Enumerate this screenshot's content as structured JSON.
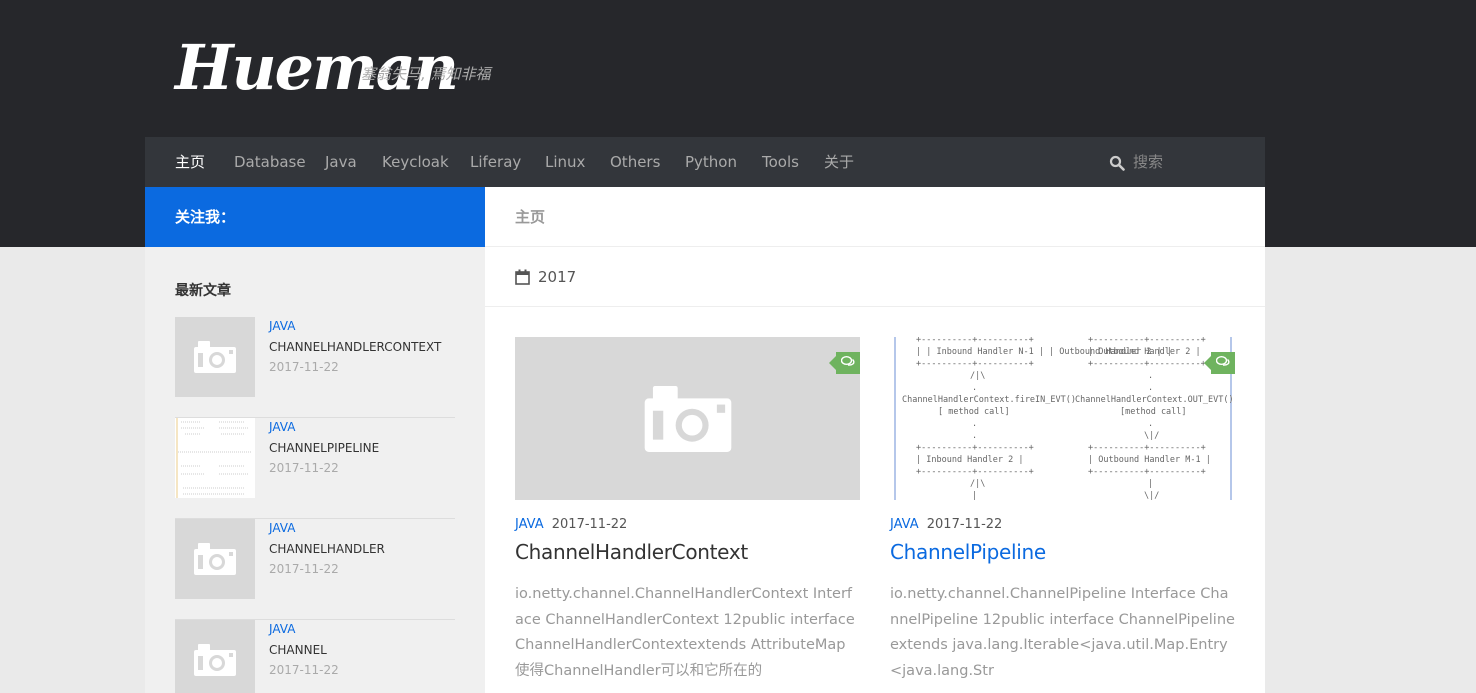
{
  "site": {
    "logo": "Hueman",
    "tagline": "塞翁失马, 焉知非福"
  },
  "nav": {
    "items": [
      {
        "label": "主页",
        "active": true
      },
      {
        "label": "Database"
      },
      {
        "label": "Java"
      },
      {
        "label": "Keycloak"
      },
      {
        "label": "Liferay"
      },
      {
        "label": "Linux"
      },
      {
        "label": "Others"
      },
      {
        "label": "Python"
      },
      {
        "label": "Tools"
      },
      {
        "label": "关于"
      }
    ],
    "search_placeholder": "搜索"
  },
  "sidebar": {
    "follow_label": "关注我：",
    "recent_title": "最新文章",
    "posts": [
      {
        "category": "JAVA",
        "title": "CHANNELHANDLERCONTEXT",
        "date": "2017-11-22",
        "thumb": "placeholder"
      },
      {
        "category": "JAVA",
        "title": "CHANNELPIPELINE",
        "date": "2017-11-22",
        "thumb": "diagram"
      },
      {
        "category": "JAVA",
        "title": "CHANNELHANDLER",
        "date": "2017-11-22",
        "thumb": "placeholder"
      },
      {
        "category": "JAVA",
        "title": "CHANNEL",
        "date": "2017-11-22",
        "thumb": "placeholder"
      }
    ]
  },
  "main": {
    "page_title": "主页",
    "archive_year": "2017",
    "cards": [
      {
        "category": "JAVA",
        "date": "2017-11-22",
        "title": "ChannelHandlerContext",
        "excerpt": "io.netty.channel.ChannelHandlerContext Interface ChannelHandlerContext 12public interface ChannelHandlerContextextends AttributeMap 使得ChannelHandler可以和它所在的",
        "thumb": "placeholder"
      },
      {
        "category": "JAVA",
        "date": "2017-11-22",
        "title": "ChannelPipeline",
        "excerpt": "io.netty.channel.ChannelPipeline Interface ChannelPipeline 12public interface ChannelPipeline extends java.lang.Iterable<java.util.Map.Entry<java.lang.Str",
        "thumb": "diagram",
        "diagram_lines": [
          "| +----------+----------+   +----------+----------+ |",
          "| | Inbound Handler N-1 |   | Outbound Handler  2  | |",
          "| +----------+----------+   +----------+----------+ |",
          "/|\\  .  |  .",
          "ChannelHandlerContext.fireIN_EVT()",
          "ChannelHandlerContext.OUT_EVT()",
          "[ method call]",
          "[method call]",
          "| Inbound Handler  2  |",
          "| Outbound Handler M-1 |"
        ]
      }
    ]
  },
  "colors": {
    "header_bg": "#26272b",
    "nav_bg": "#33363b",
    "accent_blue": "#0b6ae0",
    "comment_green": "#6fb35f"
  }
}
